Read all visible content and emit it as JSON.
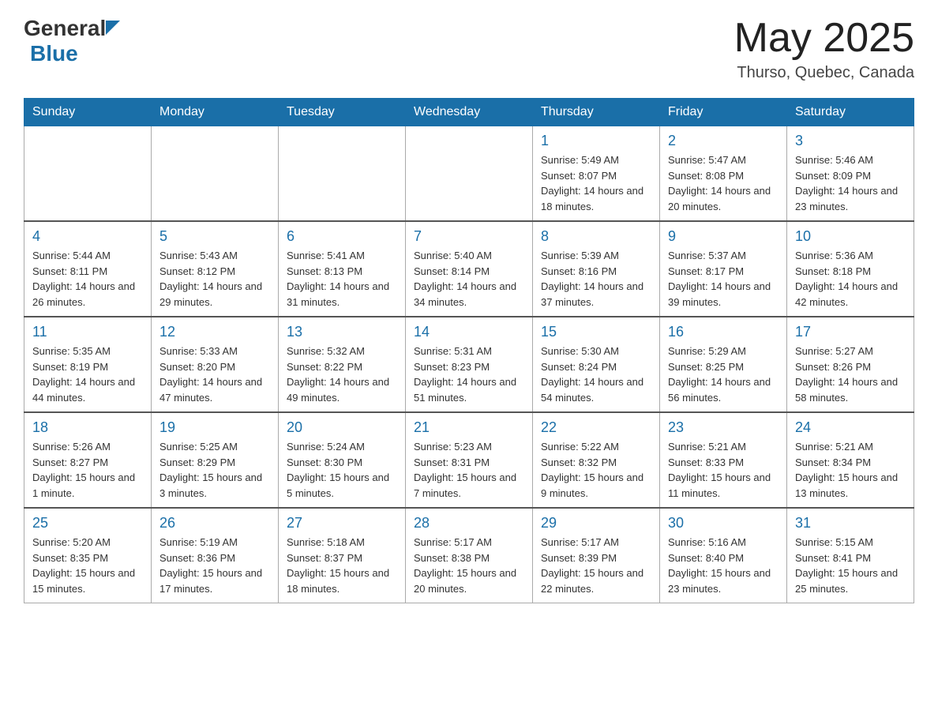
{
  "header": {
    "logo_general": "General",
    "logo_blue": "Blue",
    "month_title": "May 2025",
    "location": "Thurso, Quebec, Canada"
  },
  "weekdays": [
    "Sunday",
    "Monday",
    "Tuesday",
    "Wednesday",
    "Thursday",
    "Friday",
    "Saturday"
  ],
  "weeks": [
    [
      {
        "day": "",
        "info": ""
      },
      {
        "day": "",
        "info": ""
      },
      {
        "day": "",
        "info": ""
      },
      {
        "day": "",
        "info": ""
      },
      {
        "day": "1",
        "info": "Sunrise: 5:49 AM\nSunset: 8:07 PM\nDaylight: 14 hours and 18 minutes."
      },
      {
        "day": "2",
        "info": "Sunrise: 5:47 AM\nSunset: 8:08 PM\nDaylight: 14 hours and 20 minutes."
      },
      {
        "day": "3",
        "info": "Sunrise: 5:46 AM\nSunset: 8:09 PM\nDaylight: 14 hours and 23 minutes."
      }
    ],
    [
      {
        "day": "4",
        "info": "Sunrise: 5:44 AM\nSunset: 8:11 PM\nDaylight: 14 hours and 26 minutes."
      },
      {
        "day": "5",
        "info": "Sunrise: 5:43 AM\nSunset: 8:12 PM\nDaylight: 14 hours and 29 minutes."
      },
      {
        "day": "6",
        "info": "Sunrise: 5:41 AM\nSunset: 8:13 PM\nDaylight: 14 hours and 31 minutes."
      },
      {
        "day": "7",
        "info": "Sunrise: 5:40 AM\nSunset: 8:14 PM\nDaylight: 14 hours and 34 minutes."
      },
      {
        "day": "8",
        "info": "Sunrise: 5:39 AM\nSunset: 8:16 PM\nDaylight: 14 hours and 37 minutes."
      },
      {
        "day": "9",
        "info": "Sunrise: 5:37 AM\nSunset: 8:17 PM\nDaylight: 14 hours and 39 minutes."
      },
      {
        "day": "10",
        "info": "Sunrise: 5:36 AM\nSunset: 8:18 PM\nDaylight: 14 hours and 42 minutes."
      }
    ],
    [
      {
        "day": "11",
        "info": "Sunrise: 5:35 AM\nSunset: 8:19 PM\nDaylight: 14 hours and 44 minutes."
      },
      {
        "day": "12",
        "info": "Sunrise: 5:33 AM\nSunset: 8:20 PM\nDaylight: 14 hours and 47 minutes."
      },
      {
        "day": "13",
        "info": "Sunrise: 5:32 AM\nSunset: 8:22 PM\nDaylight: 14 hours and 49 minutes."
      },
      {
        "day": "14",
        "info": "Sunrise: 5:31 AM\nSunset: 8:23 PM\nDaylight: 14 hours and 51 minutes."
      },
      {
        "day": "15",
        "info": "Sunrise: 5:30 AM\nSunset: 8:24 PM\nDaylight: 14 hours and 54 minutes."
      },
      {
        "day": "16",
        "info": "Sunrise: 5:29 AM\nSunset: 8:25 PM\nDaylight: 14 hours and 56 minutes."
      },
      {
        "day": "17",
        "info": "Sunrise: 5:27 AM\nSunset: 8:26 PM\nDaylight: 14 hours and 58 minutes."
      }
    ],
    [
      {
        "day": "18",
        "info": "Sunrise: 5:26 AM\nSunset: 8:27 PM\nDaylight: 15 hours and 1 minute."
      },
      {
        "day": "19",
        "info": "Sunrise: 5:25 AM\nSunset: 8:29 PM\nDaylight: 15 hours and 3 minutes."
      },
      {
        "day": "20",
        "info": "Sunrise: 5:24 AM\nSunset: 8:30 PM\nDaylight: 15 hours and 5 minutes."
      },
      {
        "day": "21",
        "info": "Sunrise: 5:23 AM\nSunset: 8:31 PM\nDaylight: 15 hours and 7 minutes."
      },
      {
        "day": "22",
        "info": "Sunrise: 5:22 AM\nSunset: 8:32 PM\nDaylight: 15 hours and 9 minutes."
      },
      {
        "day": "23",
        "info": "Sunrise: 5:21 AM\nSunset: 8:33 PM\nDaylight: 15 hours and 11 minutes."
      },
      {
        "day": "24",
        "info": "Sunrise: 5:21 AM\nSunset: 8:34 PM\nDaylight: 15 hours and 13 minutes."
      }
    ],
    [
      {
        "day": "25",
        "info": "Sunrise: 5:20 AM\nSunset: 8:35 PM\nDaylight: 15 hours and 15 minutes."
      },
      {
        "day": "26",
        "info": "Sunrise: 5:19 AM\nSunset: 8:36 PM\nDaylight: 15 hours and 17 minutes."
      },
      {
        "day": "27",
        "info": "Sunrise: 5:18 AM\nSunset: 8:37 PM\nDaylight: 15 hours and 18 minutes."
      },
      {
        "day": "28",
        "info": "Sunrise: 5:17 AM\nSunset: 8:38 PM\nDaylight: 15 hours and 20 minutes."
      },
      {
        "day": "29",
        "info": "Sunrise: 5:17 AM\nSunset: 8:39 PM\nDaylight: 15 hours and 22 minutes."
      },
      {
        "day": "30",
        "info": "Sunrise: 5:16 AM\nSunset: 8:40 PM\nDaylight: 15 hours and 23 minutes."
      },
      {
        "day": "31",
        "info": "Sunrise: 5:15 AM\nSunset: 8:41 PM\nDaylight: 15 hours and 25 minutes."
      }
    ]
  ]
}
